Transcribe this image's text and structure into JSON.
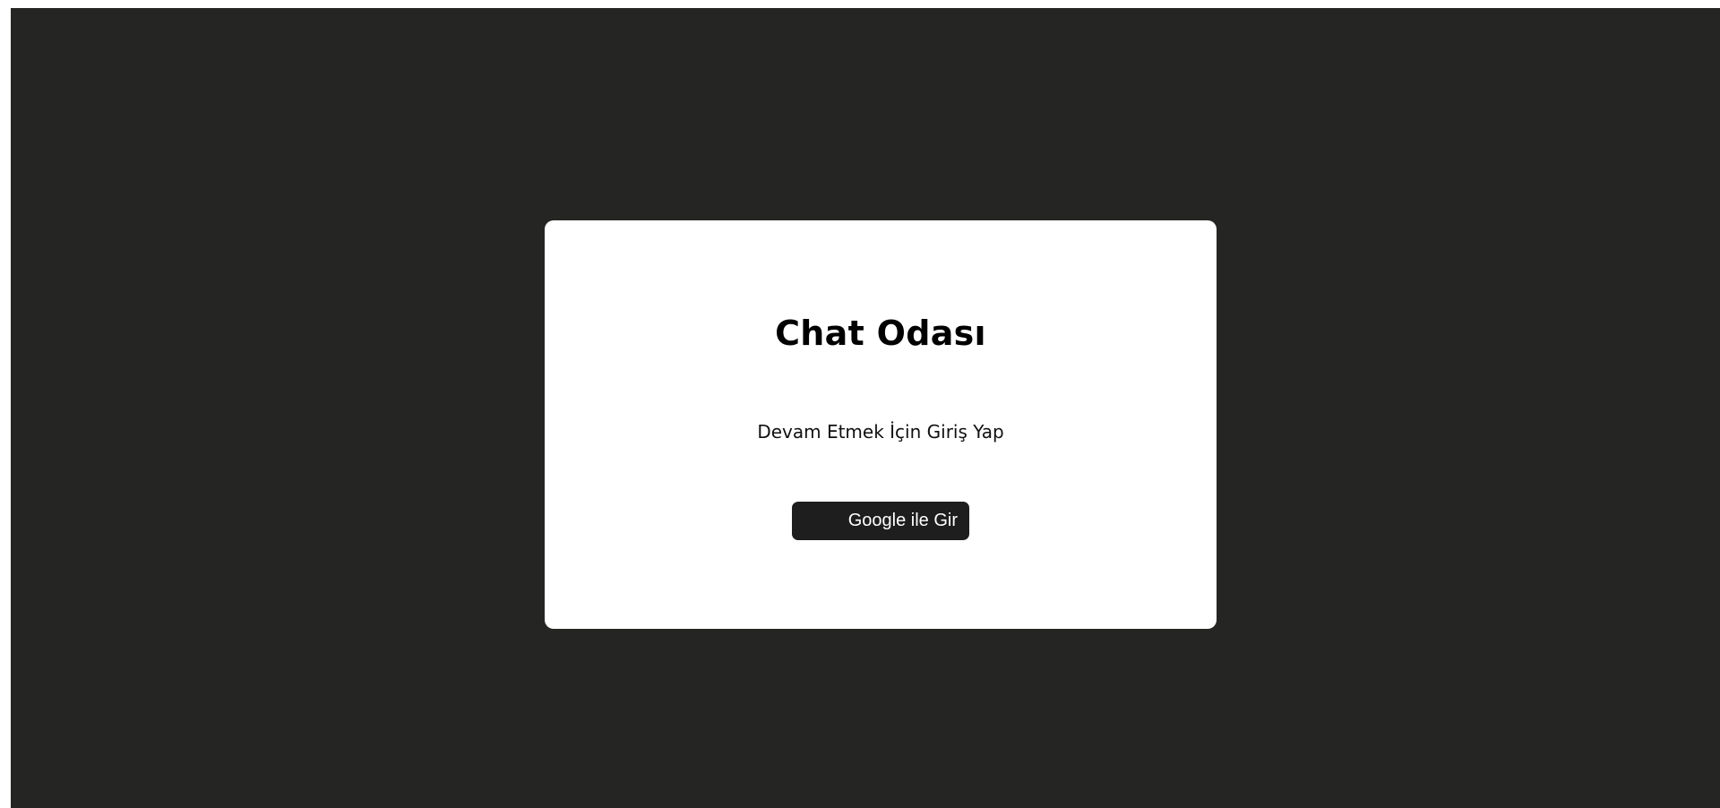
{
  "login_card": {
    "title": "Chat Odası",
    "subtitle": "Devam Etmek İçin Giriş Yap",
    "google_button_label": "Google ile Gir",
    "google_icon": "google-icon"
  },
  "colors": {
    "page_background": "#252523",
    "card_background": "#ffffff",
    "button_background": "#1e1e1e",
    "button_text": "#ffffff"
  }
}
